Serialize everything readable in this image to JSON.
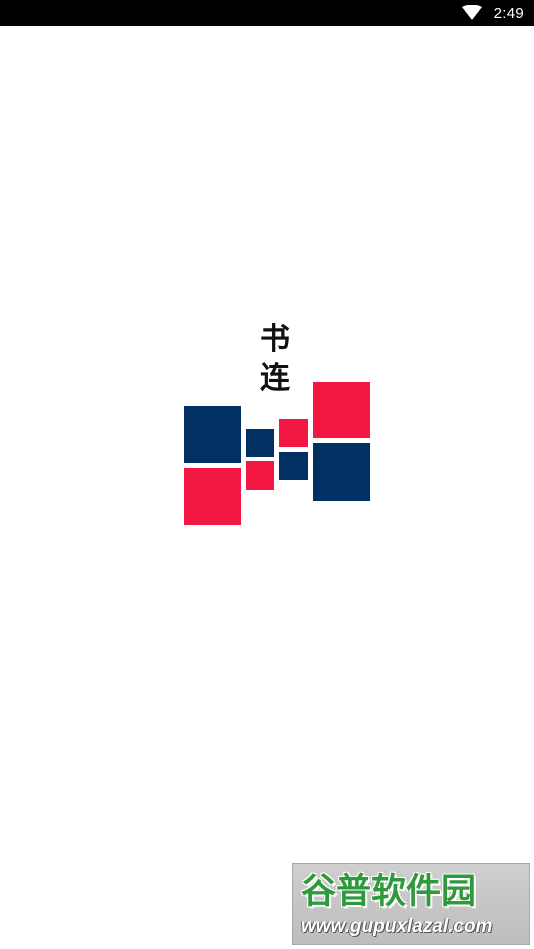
{
  "status_bar": {
    "time": "2:49",
    "icons": [
      "wifi-icon"
    ]
  },
  "splash": {
    "app_name": "书连",
    "logo_colors": {
      "navy": "#003162",
      "red": "#f31744"
    }
  },
  "watermark": {
    "brand": "谷普软件园",
    "url": "www.gupuxlazal.com"
  }
}
